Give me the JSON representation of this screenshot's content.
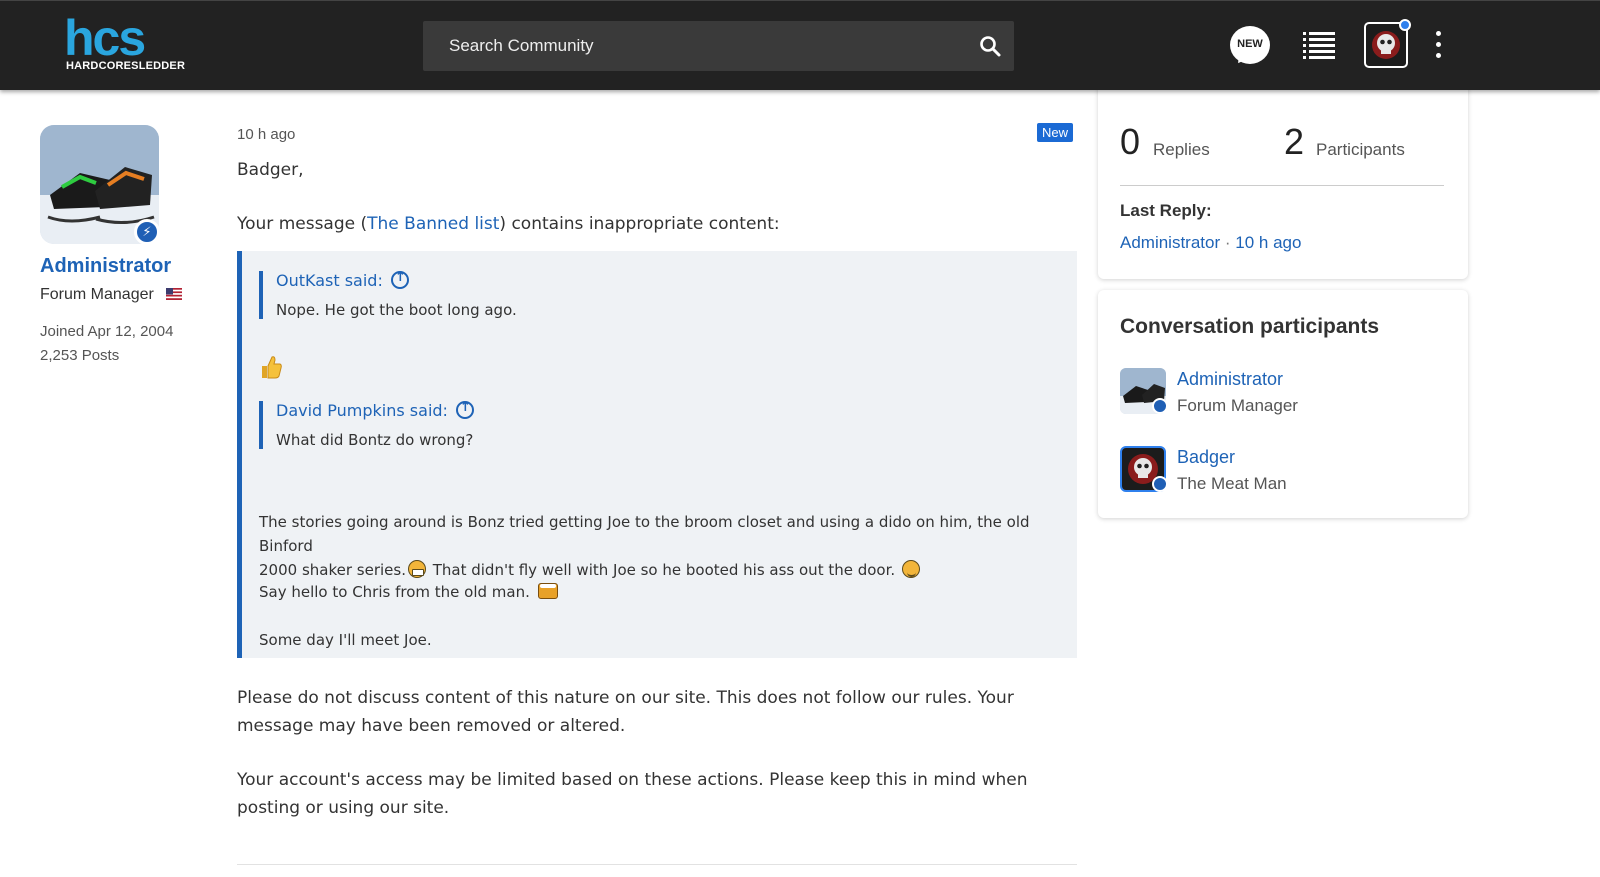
{
  "header": {
    "logo_text": "hcs",
    "logo_subtext": "HARDCORESLEDDER",
    "search_placeholder": "Search Community",
    "new_label": "NEW",
    "icons": [
      "search-icon",
      "new-posts-icon",
      "list-icon",
      "user-avatar",
      "more-vertical-icon"
    ],
    "colors": {
      "bar": "#222222",
      "logo": "#2aa6df",
      "accent": "#1e63b6"
    }
  },
  "author": {
    "name": "Administrator",
    "role": "Forum Manager",
    "joined": "Joined Apr 12, 2004",
    "posts": "2,253 Posts"
  },
  "post": {
    "time": "10 h ago",
    "new_badge": "New",
    "greeting": "Badger,",
    "intro_before": "Your message (",
    "intro_link": "The Banned list",
    "intro_after": ") contains inappropriate content:",
    "quote": {
      "q1_author": "OutKast said:",
      "q1_text": "Nope. He got the boot long ago.",
      "q2_author": "David Pumpkins said:",
      "q2_text": "What did Bontz do wrong?",
      "para1_a": "The stories going around is Bonz tried getting Joe to the broom closet and using a dido on him, the old Binford",
      "para1_b": "2000 shaker series.",
      "para1_c": " That didn't fly well with Joe so he booted his ass out the door. ",
      "para2": "Say hello to Chris from the old man. ",
      "para3": "Some day I'll meet Joe."
    },
    "warning1": "Please do not discuss content of this nature on our site. This does not follow our rules. Your message may have been removed or altered.",
    "warning2": "Your account's access may be limited based on these actions. Please keep this in mind when posting or using our site."
  },
  "sidebar": {
    "replies_count": "0",
    "replies_label": "Replies",
    "participants_count": "2",
    "participants_label": "Participants",
    "last_reply_heading": "Last Reply:",
    "last_reply_user": "Administrator",
    "last_reply_sep": "·",
    "last_reply_time": "10 h ago",
    "participants_heading": "Conversation participants",
    "participants": [
      {
        "name": "Administrator",
        "role": "Forum Manager"
      },
      {
        "name": "Badger",
        "role": "The Meat Man"
      }
    ]
  }
}
